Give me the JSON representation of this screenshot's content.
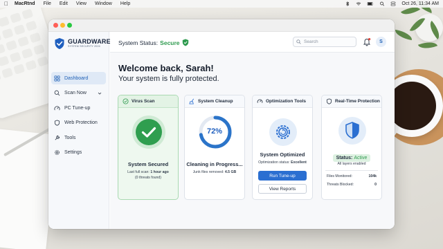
{
  "menubar": {
    "app_name": "MacRtnd",
    "items": [
      "File",
      "Edit",
      "View",
      "Window",
      "Help"
    ],
    "datetime": "Oct 26, 11:34 AM"
  },
  "sidebar": {
    "brand_name": "GUARDWARE",
    "brand_sub": "SYSTEM SECURITY 2024",
    "items": [
      {
        "label": "Dashboard",
        "icon": "grid-icon",
        "active": true
      },
      {
        "label": "Scan Now",
        "icon": "search-icon",
        "has_chevron": true
      },
      {
        "label": "PC Tune-up",
        "icon": "tune-icon"
      },
      {
        "label": "Web Protection",
        "icon": "shield-icon"
      },
      {
        "label": "Tools",
        "icon": "wrench-icon"
      },
      {
        "label": "Settings",
        "icon": "gear-icon"
      }
    ]
  },
  "header": {
    "status_label": "System Status:",
    "status_value": "Secure",
    "search_placeholder": "Search",
    "avatar_initial": "S"
  },
  "main": {
    "welcome": "Welcome back, Sarah!",
    "subtitle": "Your system is fully protected."
  },
  "cards": {
    "virus": {
      "title": "Virus Scan",
      "status": "System Secured",
      "last_scan_label": "Last full scan:",
      "last_scan_value": "1 hour ago",
      "threats": "(0 threats found)"
    },
    "cleanup": {
      "title": "System Cleanup",
      "percent": 72,
      "percent_text": "72%",
      "status": "Cleaning in Progress...",
      "junk_label": "Junk files removed:",
      "junk_value": "4.5 GB"
    },
    "optimization": {
      "title": "Optimization Tools",
      "status": "System Optimized",
      "opt_label": "Optimization status:",
      "opt_value": "Excellent",
      "button_primary": "Run Tune-up",
      "button_secondary": "View Reports"
    },
    "realtime": {
      "title": "Real-Time Protection",
      "status_label": "Status:",
      "status_value": "Active",
      "layers": "All layers enabled",
      "files_label": "Files Monitored:",
      "files_value": "104k",
      "threats_label": "Threats Blocked:",
      "threats_value": "0"
    }
  },
  "colors": {
    "accent": "#2b6fd1",
    "success": "#2e9a4e",
    "progress_ring": "#2b74c9"
  }
}
